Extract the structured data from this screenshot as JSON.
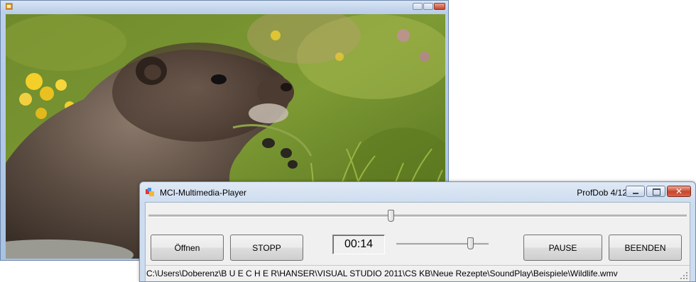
{
  "player": {
    "title": "MCI-Multimedia-Player",
    "right_title": "ProfDob 4/12",
    "buttons": {
      "open": "Öffnen",
      "stop": "STOPP",
      "pause": "PAUSE",
      "quit": "BEENDEN"
    },
    "time": "00:14",
    "position_fraction": 0.45,
    "volume_fraction": 0.8,
    "status_path": "C:\\Users\\Doberenz\\B U E C H E R\\HANSER\\VISUAL STUDIO 2011\\CS KB\\Neue Rezepte\\SoundPlay\\Beispiele\\Wildlife.wmv"
  },
  "icons": {
    "video_window": "app-icon",
    "player_window": "app-icon",
    "controls": [
      "minimize-icon",
      "maximize-icon",
      "close-icon"
    ],
    "status": "resize-grip-icon"
  },
  "colors": {
    "title_bar": "#cddcef",
    "client": "#f0f0f0",
    "close_button": "#c8442b"
  }
}
